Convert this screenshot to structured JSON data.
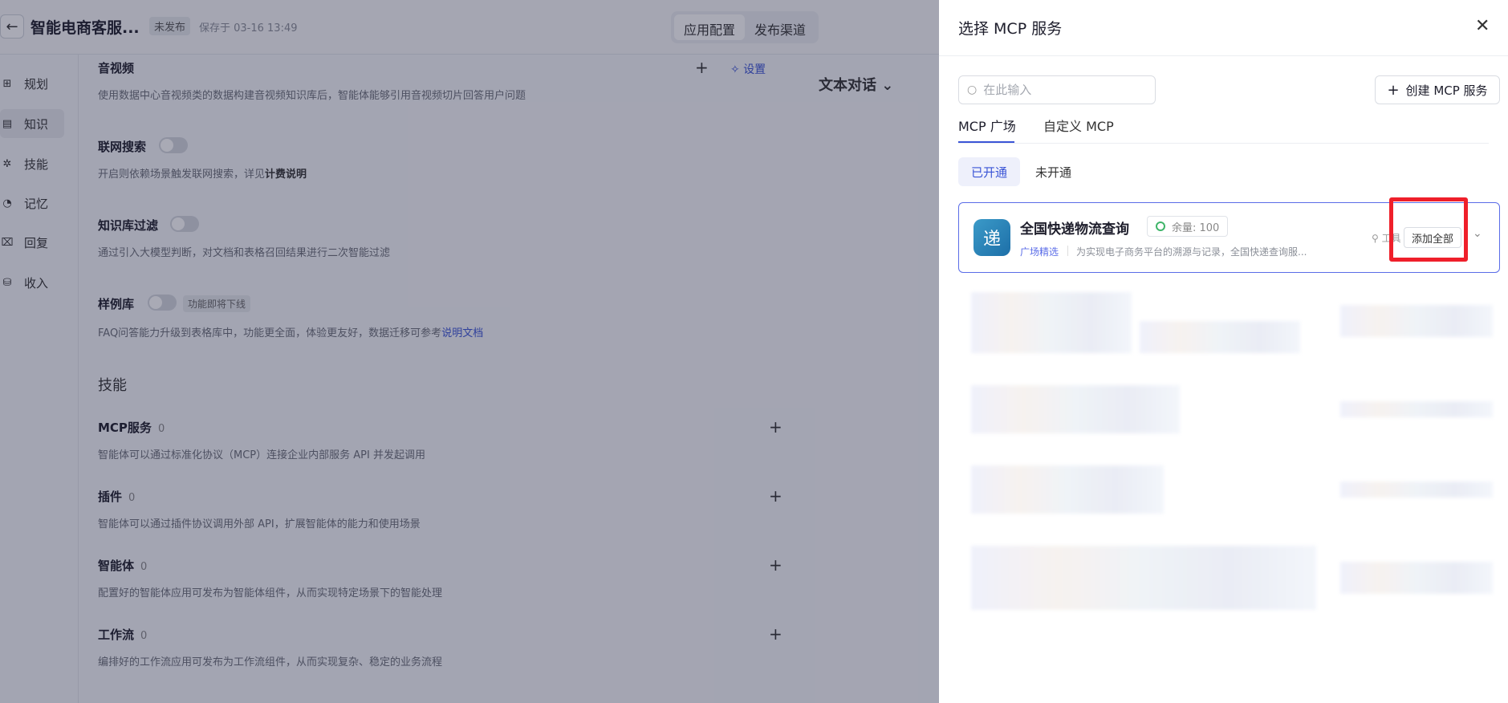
{
  "app": {
    "title": "智能电商客服...",
    "status_tag": "未发布",
    "saved": "保存于 03-16 13:49",
    "top_tabs": [
      "应用配置",
      "发布渠道"
    ]
  },
  "sidebar": {
    "items": [
      {
        "label": "规划",
        "icon": "grid-icon"
      },
      {
        "label": "知识",
        "icon": "book-icon"
      },
      {
        "label": "技能",
        "icon": "skill-icon"
      },
      {
        "label": "记忆",
        "icon": "memory-icon"
      },
      {
        "label": "回复",
        "icon": "reply-icon"
      },
      {
        "label": "收入",
        "icon": "bag-icon"
      }
    ]
  },
  "main": {
    "settings_label": "设置",
    "chat_mode": "文本对话",
    "audio": {
      "title": "音视频",
      "desc": "使用数据中心音视频类的数据构建音视频知识库后，智能体能够引用音视频切片回答用户问题"
    },
    "web_search": {
      "title": "联网搜索",
      "desc_prefix": "开启则依赖场景触发联网搜索，详见",
      "desc_bold": "计费说明"
    },
    "kb_filter": {
      "title": "知识库过滤",
      "desc": "通过引入大模型判断，对文档和表格召回结果进行二次智能过滤"
    },
    "examples": {
      "title": "样例库",
      "soon": "功能即将下线",
      "desc_prefix": "FAQ问答能力升级到表格库中，功能更全面，体验更友好，数据迁移可参考",
      "desc_link": "说明文档"
    },
    "skills_head": "技能",
    "mcp": {
      "title": "MCP服务",
      "count": "0",
      "desc": "智能体可以通过标准化协议（MCP）连接企业内部服务 API 并发起调用"
    },
    "plugin": {
      "title": "插件",
      "count": "0",
      "desc": "智能体可以通过插件协议调用外部 API，扩展智能体的能力和使用场景"
    },
    "agent": {
      "title": "智能体",
      "count": "0",
      "desc": "配置好的智能体应用可发布为智能体组件，从而实现特定场景下的智能处理"
    },
    "workflow": {
      "title": "工作流",
      "count": "0",
      "desc": "编排好的工作流应用可发布为工作流组件，从而实现复杂、稳定的业务流程"
    }
  },
  "drawer": {
    "title": "选择 MCP 服务",
    "search_placeholder": "在此输入",
    "create_label": "创建 MCP 服务",
    "tabs": [
      "MCP 广场",
      "自定义 MCP"
    ],
    "segments": [
      "已开通",
      "未开通"
    ],
    "card": {
      "logo_char": "递",
      "name": "全国快递物流查询",
      "quota": "余量: 100",
      "tag": "广场精选",
      "desc": "为实现电子商务平台的溯源与记录，全国快递查询服...",
      "tool": "工具",
      "add_all": "添加全部"
    }
  },
  "colors": {
    "accent": "#3b55d6",
    "highlight": "#ef1f2a"
  }
}
